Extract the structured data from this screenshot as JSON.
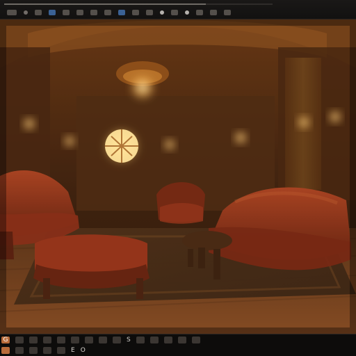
{
  "app": {
    "progress_percent": 75
  },
  "toolbar_top": {
    "icons": [
      "grid-icon",
      "dot-icon",
      "pencil-icon",
      "camera-icon",
      "layers-icon",
      "bookmark-icon",
      "frame-icon",
      "sparkle-icon",
      "window-icon",
      "panel-icon",
      "image-icon",
      "mask-icon",
      "gear-icon",
      "dot-icon",
      "rectangle-icon",
      "settings-icon",
      "square-icon"
    ]
  },
  "toolbar_bottom": {
    "row1": [
      "G",
      "",
      "",
      "",
      "",
      "",
      "",
      "",
      "",
      "S",
      "",
      "",
      "",
      "",
      ""
    ],
    "row2": [
      "",
      "",
      "",
      "",
      "",
      "E",
      "O"
    ]
  },
  "scene": {
    "palette": {
      "wall_dark": "#2b1409",
      "wall_gold": "#b77a2e",
      "sofa_red": "#7d2414",
      "floor_wood": "#6b3b1a",
      "glow": "#ffcc66"
    }
  }
}
